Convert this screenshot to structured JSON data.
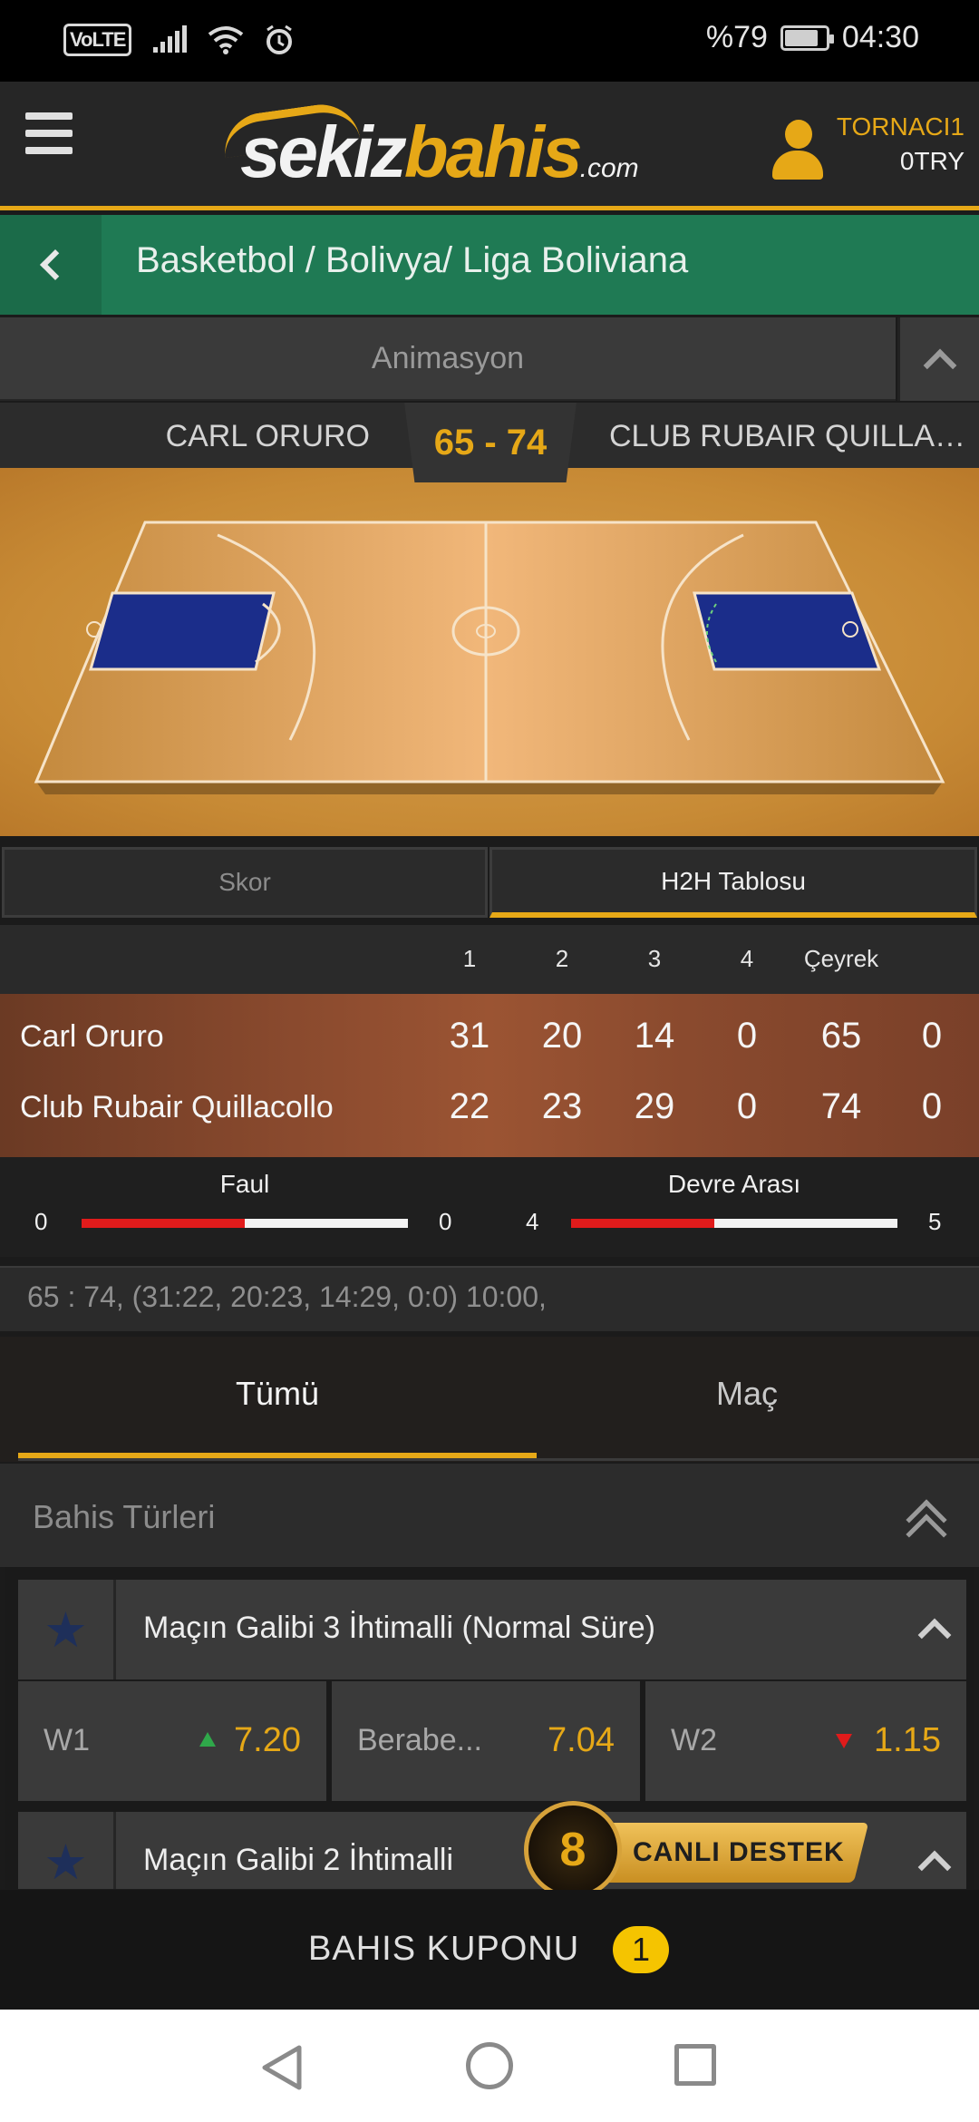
{
  "status_bar": {
    "volte": "VoLTE",
    "battery_percent": "%79",
    "time": "04:30",
    "icons": [
      "signal-icon",
      "wifi-icon",
      "alarm-icon",
      "battery-icon"
    ]
  },
  "header": {
    "logo_main": "sekiz",
    "logo_accent": "bahis",
    "logo_suffix": ".com",
    "username": "TORNACI1",
    "balance": "0TRY"
  },
  "breadcrumb": {
    "text": "Basketbol / Bolivya/ Liga Boliviana"
  },
  "animation": {
    "label": "Animasyon"
  },
  "match": {
    "home_team": "CARL ORURO",
    "away_team": "CLUB RUBAIR QUILLACOLLO",
    "score": "65 - 74"
  },
  "score_tabs": {
    "skor": "Skor",
    "h2h": "H2H Tablosu"
  },
  "quarter_table": {
    "headers": [
      "1",
      "2",
      "3",
      "4",
      "Çeyrek",
      ""
    ],
    "rows": [
      {
        "team": "Carl Oruro",
        "values": [
          "31",
          "20",
          "14",
          "0",
          "65",
          "0"
        ]
      },
      {
        "team": "Club Rubair Quillacollo",
        "values": [
          "22",
          "23",
          "29",
          "0",
          "74",
          "0"
        ]
      }
    ]
  },
  "stats": [
    {
      "title": "Faul",
      "left": "0",
      "right": "0",
      "fill_fraction": 0.5
    },
    {
      "title": "Devre Arası",
      "left": "4",
      "right": "5",
      "fill_fraction": 0.44
    }
  ],
  "summary": "65 : 74, (31:22, 20:23, 14:29, 0:0) 10:00,",
  "main_tabs": {
    "tumu": "Tümü",
    "mac": "Maç"
  },
  "bet_types": {
    "title": "Bahis Türleri"
  },
  "markets": [
    {
      "title": "Maçın Galibi 3 İhtimalli (Normal Süre)",
      "odds": [
        {
          "label": "W1",
          "value": "7.20",
          "trend": "up"
        },
        {
          "label": "Berabe...",
          "value": "7.04",
          "trend": "none"
        },
        {
          "label": "W2",
          "value": "1.15",
          "trend": "down"
        }
      ]
    },
    {
      "title": "Maçın Galibi 2 İhtimalli"
    }
  ],
  "live_support": {
    "label_a": "CANLI",
    "label_b": "DESTEK",
    "logo_glyph": "8"
  },
  "coupon": {
    "label": "BAHIS KUPONU",
    "count": "1"
  },
  "colors": {
    "accent": "#e6a817",
    "breadcrumb_green": "#1f7a54",
    "odd_up": "#2fa84a",
    "odd_down": "#e01b1b"
  }
}
